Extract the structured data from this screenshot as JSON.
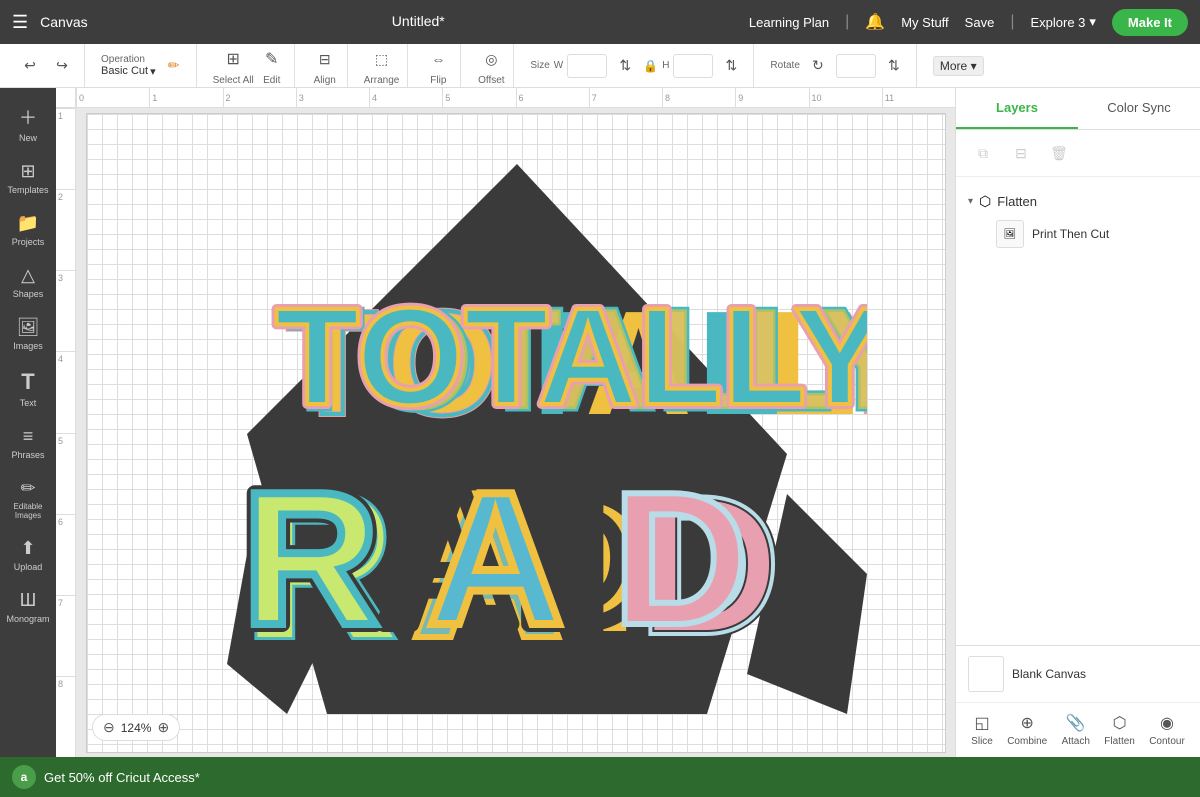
{
  "topbar": {
    "menu_icon": "☰",
    "canvas_label": "Canvas",
    "doc_title": "Untitled*",
    "learning_plan": "Learning Plan",
    "bell_icon": "🔔",
    "my_stuff": "My Stuff",
    "save": "Save",
    "explore": "Explore 3",
    "make_it": "Make It"
  },
  "toolbar": {
    "operation_label": "Operation",
    "operation_value": "Basic Cut",
    "select_all": "Select All",
    "edit": "Edit",
    "align": "Align",
    "arrange": "Arrange",
    "flip": "Flip",
    "offset": "Offset",
    "size_label": "Size",
    "size_w": "W",
    "size_h": "H",
    "rotate": "Rotate",
    "more": "More ▾",
    "undo": "↩",
    "redo": "↪"
  },
  "sidebar": {
    "items": [
      {
        "label": "New",
        "icon": "＋"
      },
      {
        "label": "Templates",
        "icon": "⊞"
      },
      {
        "label": "Projects",
        "icon": "📁"
      },
      {
        "label": "Shapes",
        "icon": "△"
      },
      {
        "label": "Images",
        "icon": "🖼"
      },
      {
        "label": "Text",
        "icon": "T"
      },
      {
        "label": "Phrases",
        "icon": "≡"
      },
      {
        "label": "Editable\nImages",
        "icon": "✏"
      },
      {
        "label": "Upload",
        "icon": "⬆"
      },
      {
        "label": "Monogram",
        "icon": "M"
      }
    ]
  },
  "ruler": {
    "h_marks": [
      "0",
      "1",
      "2",
      "3",
      "4",
      "5",
      "6",
      "7",
      "8",
      "9",
      "10",
      "11"
    ],
    "v_marks": [
      "1",
      "2",
      "3",
      "4",
      "5",
      "6",
      "7",
      "8"
    ]
  },
  "zoom": {
    "level": "124%",
    "minus": "⊖",
    "plus": "⊕"
  },
  "right_panel": {
    "tabs": [
      {
        "label": "Layers",
        "active": true
      },
      {
        "label": "Color Sync",
        "active": false
      }
    ],
    "actions": {
      "duplicate": "⧉",
      "group": "⊟",
      "delete": "🗑"
    },
    "layers": {
      "group": {
        "label": "Flatten",
        "icon": "⬡",
        "expanded": true
      },
      "items": [
        {
          "label": "Print Then Cut",
          "thumb": "🖼"
        }
      ]
    },
    "blank_canvas": {
      "label": "Blank Canvas"
    },
    "bottom_actions": [
      {
        "label": "Slice",
        "icon": "◱"
      },
      {
        "label": "Combine",
        "icon": "⊕"
      },
      {
        "label": "Attach",
        "icon": "📎"
      },
      {
        "label": "Flatten",
        "icon": "⬡"
      },
      {
        "label": "Contour",
        "icon": "◉"
      }
    ]
  },
  "promo": {
    "icon": "a",
    "text": "Get 50% off Cricut Access*"
  }
}
